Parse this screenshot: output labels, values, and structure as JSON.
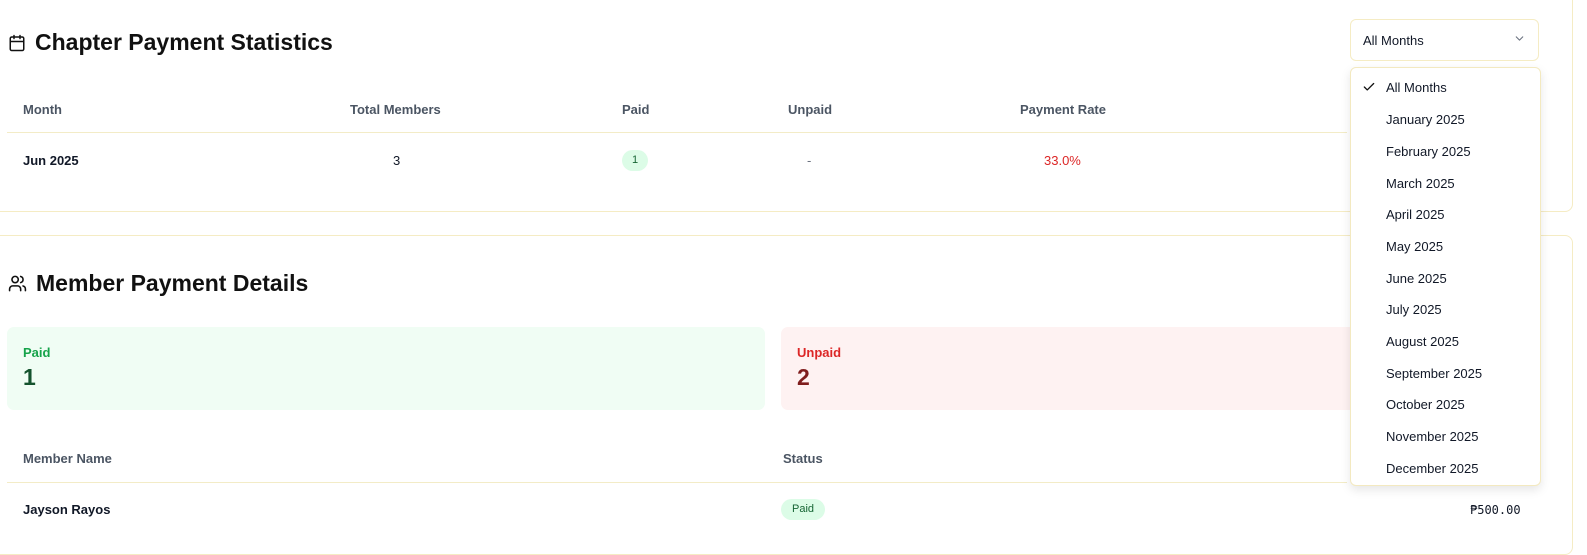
{
  "stats": {
    "title": "Chapter Payment Statistics",
    "columns": [
      "Month",
      "Total Members",
      "Paid",
      "Unpaid",
      "Payment Rate"
    ],
    "row": {
      "month": "Jun 2025",
      "total": "3",
      "paid": "1",
      "unpaid": "-",
      "rate": "33.0%"
    }
  },
  "members": {
    "title": "Member Payment Details",
    "summary": {
      "paid_label": "Paid",
      "paid_value": "1",
      "unpaid_label": "Unpaid",
      "unpaid_value": "2"
    },
    "columns": [
      "Member Name",
      "Status"
    ],
    "rows": [
      {
        "name": "Jayson Rayos",
        "status": "Paid",
        "amount": "₱500.00"
      }
    ]
  },
  "filter": {
    "selected": "All Months",
    "options": [
      "All Months",
      "January 2025",
      "February 2025",
      "March 2025",
      "April 2025",
      "May 2025",
      "June 2025",
      "July 2025",
      "August 2025",
      "September 2025",
      "October 2025",
      "November 2025",
      "December 2025"
    ]
  },
  "icons": {
    "stats": "calendar-icon",
    "members": "users-icon",
    "select": "chevron-down-icon",
    "selected": "check-icon"
  },
  "colors": {
    "border": "#f5ecc4",
    "paid": "#16a34a",
    "unpaid": "#dc2626",
    "paid_bg": "#f0fdf4",
    "unpaid_bg": "#fef2f2"
  }
}
